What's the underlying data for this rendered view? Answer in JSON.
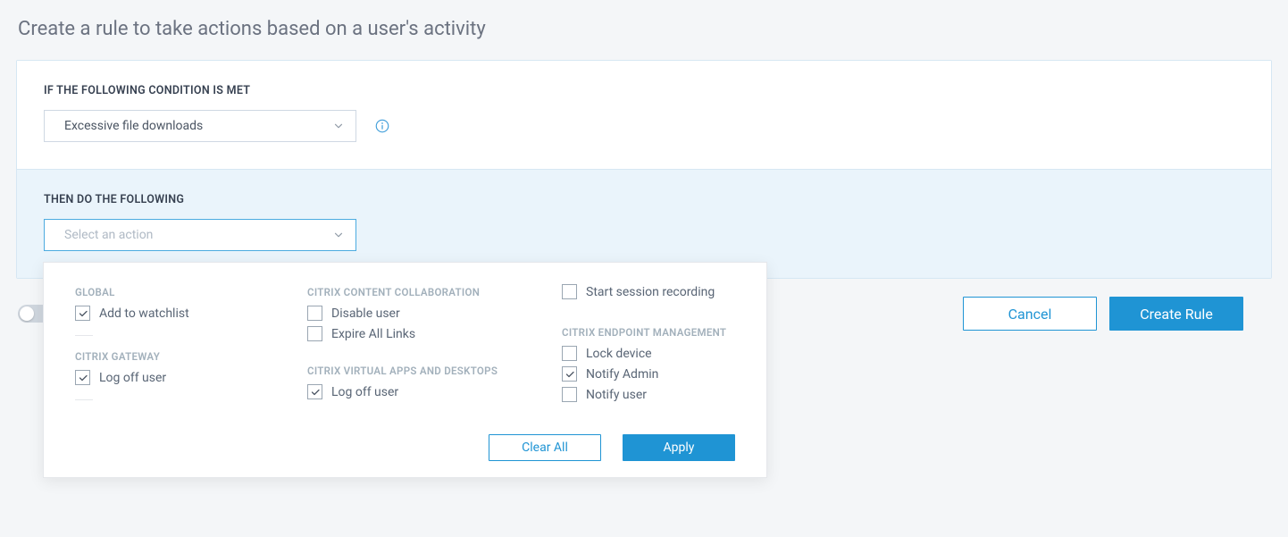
{
  "page_title": "Create a rule to take actions based on a user's activity",
  "condition": {
    "section_label": "IF THE FOLLOWING CONDITION IS MET",
    "selected": "Excessive file downloads"
  },
  "action": {
    "section_label": "THEN DO THE FOLLOWING",
    "placeholder": "Select an action"
  },
  "dropdown": {
    "groups": {
      "global": {
        "label": "GLOBAL",
        "options": {
          "add_watchlist": {
            "label": "Add to watchlist",
            "checked": true
          }
        }
      },
      "gateway": {
        "label": "CITRIX GATEWAY",
        "options": {
          "logoff_gateway": {
            "label": "Log off user",
            "checked": true
          }
        }
      },
      "ccc": {
        "label": "CITRIX CONTENT COLLABORATION",
        "options": {
          "disable_user": {
            "label": "Disable user",
            "checked": false
          },
          "expire_links": {
            "label": "Expire All Links",
            "checked": false
          }
        }
      },
      "cvad": {
        "label": "CITRIX VIRTUAL APPS AND DESKTOPS",
        "options": {
          "logoff_cvad": {
            "label": "Log off user",
            "checked": true
          }
        }
      },
      "floating": {
        "options": {
          "start_recording": {
            "label": "Start session recording",
            "checked": false
          }
        }
      },
      "cem": {
        "label": "CITRIX ENDPOINT MANAGEMENT",
        "options": {
          "lock_device": {
            "label": "Lock device",
            "checked": false
          },
          "notify_admin": {
            "label": "Notify Admin",
            "checked": true
          },
          "notify_user": {
            "label": "Notify user",
            "checked": false
          }
        }
      }
    },
    "buttons": {
      "clear": "Clear All",
      "apply": "Apply"
    }
  },
  "footer": {
    "cancel": "Cancel",
    "create": "Create Rule"
  }
}
